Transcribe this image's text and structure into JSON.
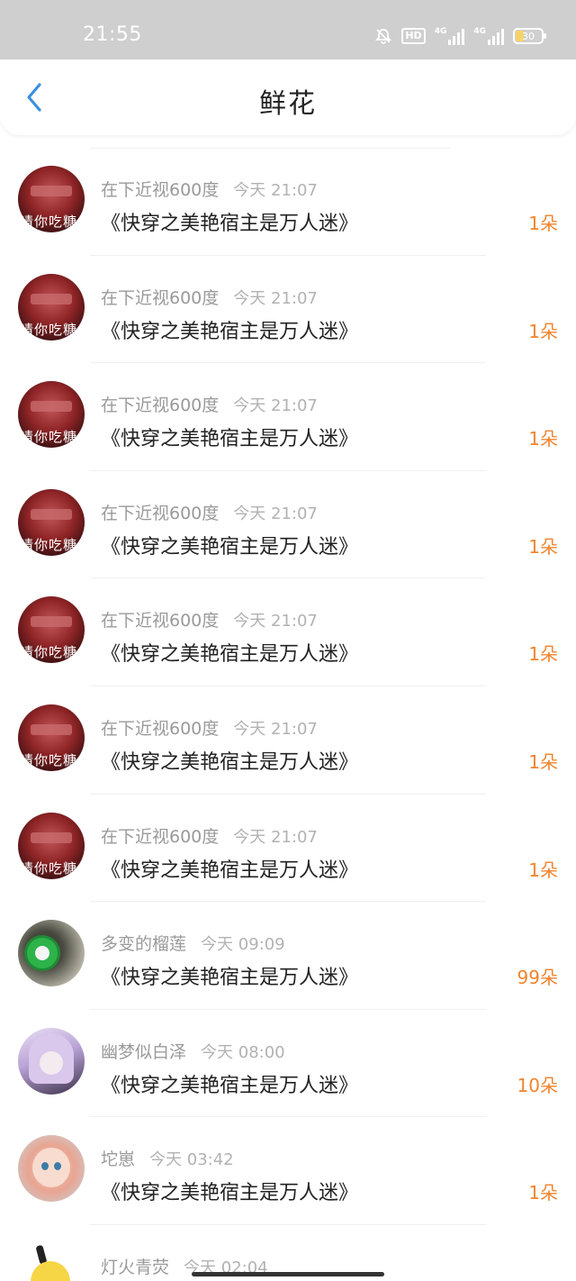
{
  "status_bar": {
    "time": "21:55",
    "hd_label": "HD",
    "network_1": "4G",
    "network_2": "4G",
    "battery_level": "30"
  },
  "header": {
    "title": "鲜花"
  },
  "items": [
    {
      "user": "在下近视600度",
      "time": "今天 21:07",
      "book": "《快穿之美艳宿主是万人迷》",
      "count": "1朵",
      "avatar_text": "请你吃糖"
    },
    {
      "user": "在下近视600度",
      "time": "今天 21:07",
      "book": "《快穿之美艳宿主是万人迷》",
      "count": "1朵",
      "avatar_text": "请你吃糖"
    },
    {
      "user": "在下近视600度",
      "time": "今天 21:07",
      "book": "《快穿之美艳宿主是万人迷》",
      "count": "1朵",
      "avatar_text": "请你吃糖"
    },
    {
      "user": "在下近视600度",
      "time": "今天 21:07",
      "book": "《快穿之美艳宿主是万人迷》",
      "count": "1朵",
      "avatar_text": "请你吃糖"
    },
    {
      "user": "在下近视600度",
      "time": "今天 21:07",
      "book": "《快穿之美艳宿主是万人迷》",
      "count": "1朵",
      "avatar_text": "请你吃糖"
    },
    {
      "user": "在下近视600度",
      "time": "今天 21:07",
      "book": "《快穿之美艳宿主是万人迷》",
      "count": "1朵",
      "avatar_text": "请你吃糖"
    },
    {
      "user": "在下近视600度",
      "time": "今天 21:07",
      "book": "《快穿之美艳宿主是万人迷》",
      "count": "1朵",
      "avatar_text": "请你吃糖"
    },
    {
      "user": "多变的榴莲",
      "time": "今天 09:09",
      "book": "《快穿之美艳宿主是万人迷》",
      "count": "99朵"
    },
    {
      "user": "幽梦似白泽",
      "time": "今天 08:00",
      "book": "《快穿之美艳宿主是万人迷》",
      "count": "10朵"
    },
    {
      "user": "坨崽",
      "time": "今天 03:42",
      "book": "《快穿之美艳宿主是万人迷》",
      "count": "1朵"
    },
    {
      "user": "灯火青荧",
      "time": "今天 02:04"
    }
  ],
  "colors": {
    "accent": "#f0842d",
    "back_icon": "#3b8fe0",
    "status_bar_bg": "#cfcfcf"
  }
}
